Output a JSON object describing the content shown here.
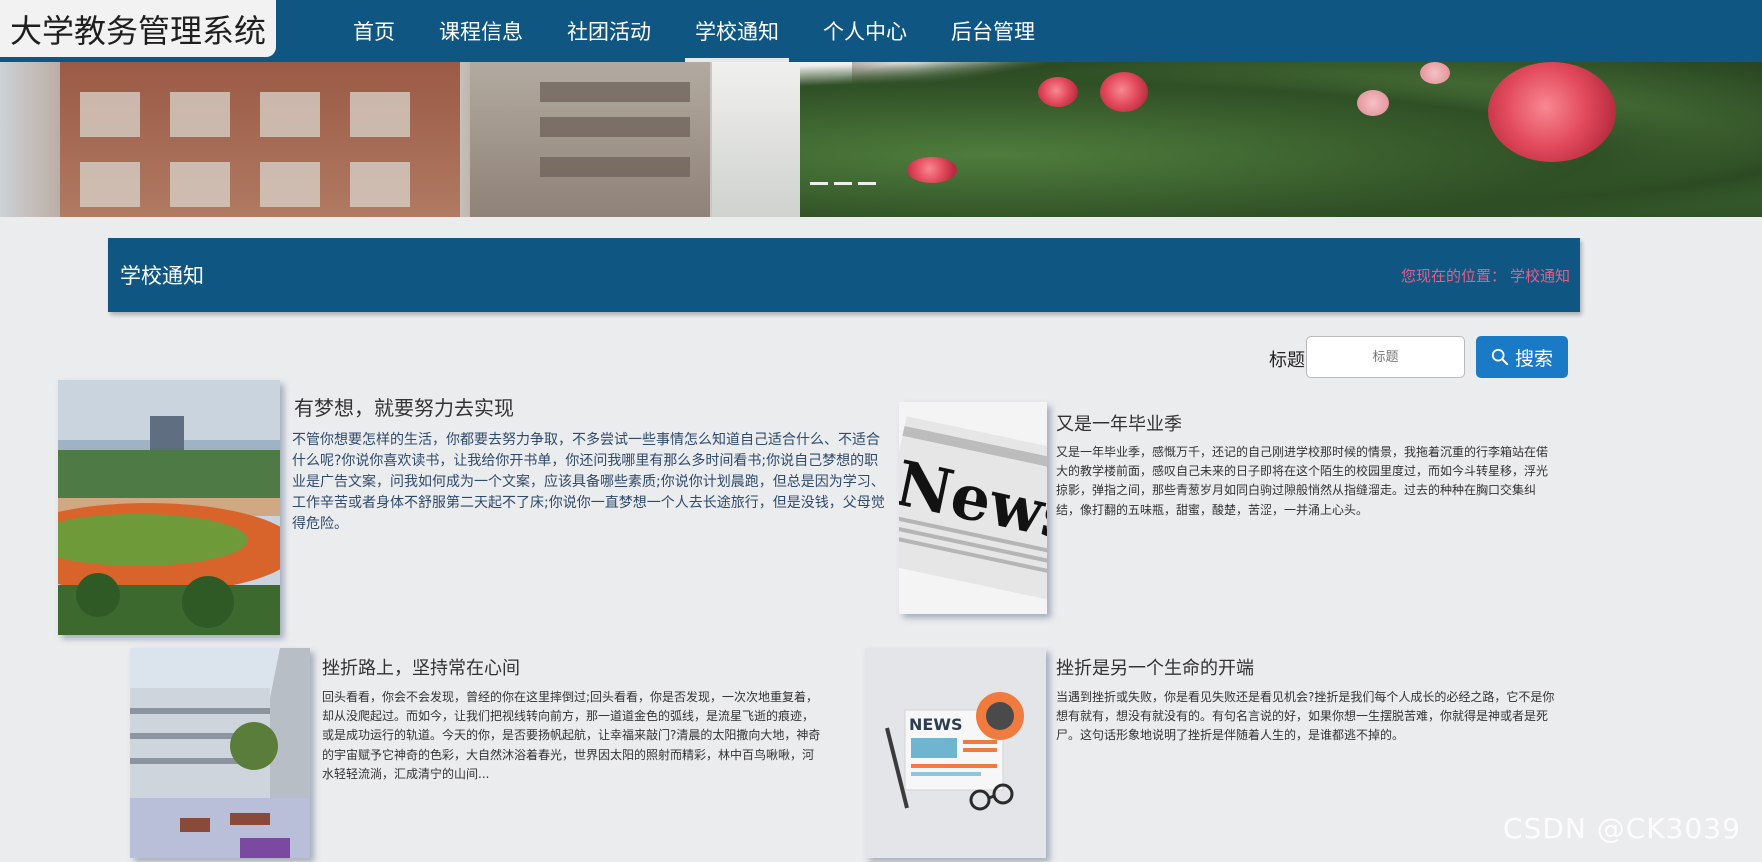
{
  "app": {
    "title": "大学教务管理系统"
  },
  "nav": {
    "items": [
      "首页",
      "课程信息",
      "社团活动",
      "学校通知",
      "个人中心",
      "后台管理"
    ],
    "active_index": 3
  },
  "banner": {
    "slide_count": 3,
    "active_slide": 0
  },
  "section": {
    "title": "学校通知",
    "breadcrumb_label": "您现在的位置：",
    "breadcrumb_value": "学校通知"
  },
  "search": {
    "label": "标题",
    "placeholder": "标题",
    "value": "",
    "button_label": "搜索"
  },
  "notices": [
    {
      "title": "有梦想，就要努力去实现",
      "content": "不管你想要怎样的生活，你都要去努力争取，不多尝试一些事情怎么知道自己适合什么、不适合什么呢?你说你喜欢读书，让我给你开书单，你还问我哪里有那么多时间看书;你说自己梦想的职业是广告文案，问我如何成为一个文案，应该具备哪些素质;你说你计划晨跑，但总是因为学习、工作辛苦或者身体不舒服第二天起不了床;你说你一直梦想一个人去长途旅行，但是没钱，父母觉得危险。",
      "image": "campus-track-photo"
    },
    {
      "title": "又是一年毕业季",
      "content": "又是一年毕业季，感慨万千，还记的自己刚进学校那时候的情景，我拖着沉重的行李箱站在偌大的教学楼前面，感叹自己未来的日子即将在这个陌生的校园里度过，而如今斗转星移，浮光掠影，弹指之间，那些青葱岁月如同白驹过隙般悄然从指缝溜走。过去的种种在胸口交集纠结，像打翻的五味瓶，甜蜜，酸楚，苦涩，一并涌上心头。",
      "image": "news-newspaper-photo"
    },
    {
      "title": "挫折路上，坚持常在心间",
      "content": "回头看看，你会不会发现，曾经的你在这里摔倒过;回头看看，你是否发现，一次次地重复着，却从没爬起过。而如今，让我们把视线转向前方，那一道道金色的弧线，是流星飞逝的痕迹，或是成功运行的轨道。今天的你，是否要扬帆起航，让幸福来敲门?清晨的太阳撒向大地，神奇的宇宙赋予它神奇的色彩，大自然沐浴着春光，世界因太阳的照射而精彩，林中百鸟啾啾，河水轻轻流淌，汇成清宁的山间...",
      "image": "campus-courtyard-photo"
    },
    {
      "title": "挫折是另一个生命的开端",
      "content": "当遇到挫折或失败，你是看见失败还是看见机会?挫折是我们每个人成长的必经之路，它不是你想有就有，想没有就没有的。有句名言说的好，如果你想一生摆脱苦难，你就得是神或者是死尸。这句话形象地说明了挫折是伴随着人生的，是谁都逃不掉的。",
      "image": "news-flat-illustration"
    }
  ],
  "illustration": {
    "news_word": "News",
    "news_badge": "NEWS"
  },
  "watermark": "CSDN @CK3039"
}
